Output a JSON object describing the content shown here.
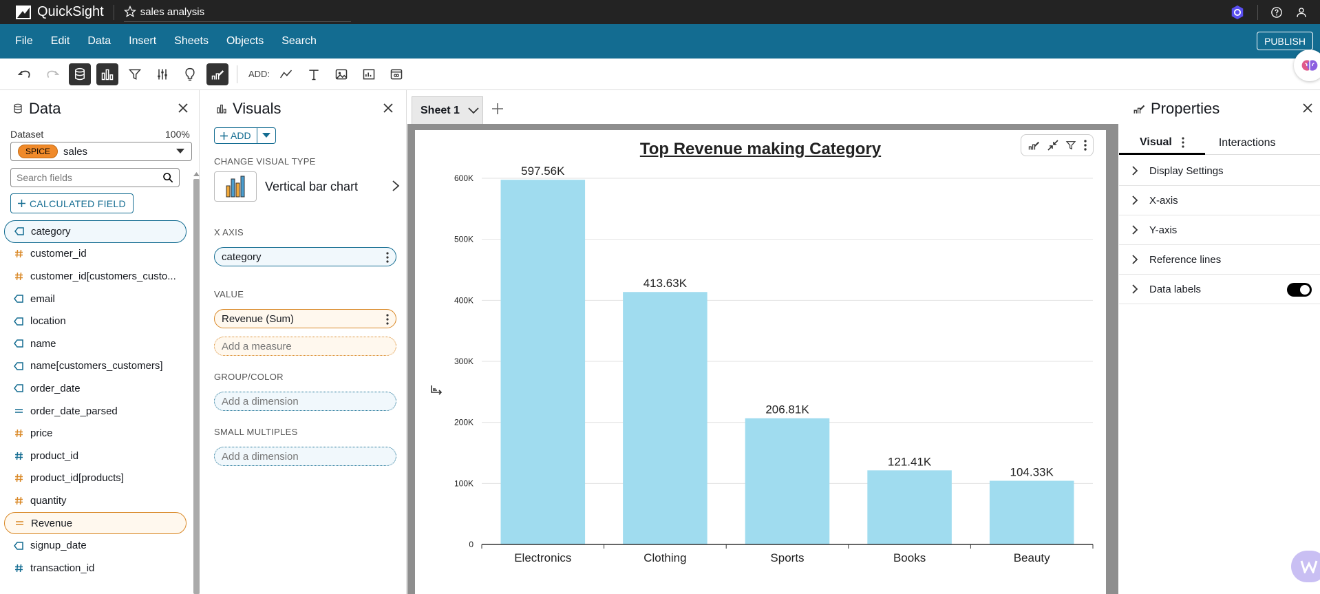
{
  "topbar": {
    "brand": "QuickSight",
    "analysis_name": "sales analysis"
  },
  "menu": [
    "File",
    "Edit",
    "Data",
    "Insert",
    "Sheets",
    "Objects",
    "Search"
  ],
  "publish_label": "PUBLISH",
  "toolbar": {
    "add_label": "ADD:"
  },
  "data_panel": {
    "title": "Data",
    "dataset_label": "Dataset",
    "dataset_pct": "100%",
    "spice_badge": "SPICE",
    "dataset_name": "sales",
    "search_placeholder": "Search fields",
    "calc_field_label": "CALCULATED FIELD",
    "fields": [
      {
        "name": "category",
        "kind": "dim",
        "icon": "tag-icon"
      },
      {
        "name": "customer_id",
        "kind": "mea",
        "icon": "hash-icon"
      },
      {
        "name": "customer_id[customers_custo...",
        "kind": "mea",
        "icon": "hash-icon"
      },
      {
        "name": "email",
        "kind": "dim",
        "icon": "tag-icon"
      },
      {
        "name": "location",
        "kind": "dim",
        "icon": "tag-icon"
      },
      {
        "name": "name",
        "kind": "dim",
        "icon": "tag-icon"
      },
      {
        "name": "name[customers_customers]",
        "kind": "dim",
        "icon": "tag-icon"
      },
      {
        "name": "order_date",
        "kind": "dim",
        "icon": "tag-icon"
      },
      {
        "name": "order_date_parsed",
        "kind": "dim",
        "icon": "calc-icon"
      },
      {
        "name": "price",
        "kind": "mea",
        "icon": "hash-icon"
      },
      {
        "name": "product_id",
        "kind": "dim",
        "icon": "hash-icon"
      },
      {
        "name": "product_id[products]",
        "kind": "mea",
        "icon": "hash-icon"
      },
      {
        "name": "quantity",
        "kind": "mea",
        "icon": "hash-icon"
      },
      {
        "name": "Revenue",
        "kind": "mea",
        "icon": "calc-icon"
      },
      {
        "name": "signup_date",
        "kind": "dim",
        "icon": "tag-icon"
      },
      {
        "name": "transaction_id",
        "kind": "dim",
        "icon": "hash-icon"
      }
    ]
  },
  "visuals_panel": {
    "title": "Visuals",
    "add_label": "ADD",
    "change_type_label": "CHANGE VISUAL TYPE",
    "visual_type": "Vertical bar chart",
    "x_axis_label": "X AXIS",
    "x_axis_field": "category",
    "value_label": "VALUE",
    "value_field": "Revenue (Sum)",
    "add_measure": "Add a measure",
    "group_label": "GROUP/COLOR",
    "add_dimension": "Add a dimension",
    "small_multiples_label": "SMALL MULTIPLES",
    "add_dimension_2": "Add a dimension"
  },
  "sheet": {
    "tab_name": "Sheet 1"
  },
  "chart_data": {
    "type": "bar",
    "title": "Top Revenue making Category",
    "categories": [
      "Electronics",
      "Clothing",
      "Sports",
      "Books",
      "Beauty"
    ],
    "values": [
      597560,
      413630,
      206810,
      121410,
      104330
    ],
    "data_labels": [
      "597.56K",
      "413.63K",
      "206.81K",
      "121.41K",
      "104.33K"
    ],
    "y_ticks": [
      0,
      100000,
      200000,
      300000,
      400000,
      500000,
      600000
    ],
    "y_tick_labels": [
      "0",
      "100K",
      "200K",
      "300K",
      "400K",
      "500K",
      "600K"
    ],
    "ylim": [
      0,
      600000
    ],
    "grid": true,
    "bar_color": "#a0dcef"
  },
  "properties_panel": {
    "title": "Properties",
    "tab_visual": "Visual",
    "tab_interactions": "Interactions",
    "rows": [
      "Display Settings",
      "X-axis",
      "Y-axis",
      "Reference lines",
      "Data labels"
    ]
  },
  "colors": {
    "menubar": "#136c91",
    "topbar": "#232323",
    "dimension": "#136c91",
    "measure": "#d98826"
  }
}
